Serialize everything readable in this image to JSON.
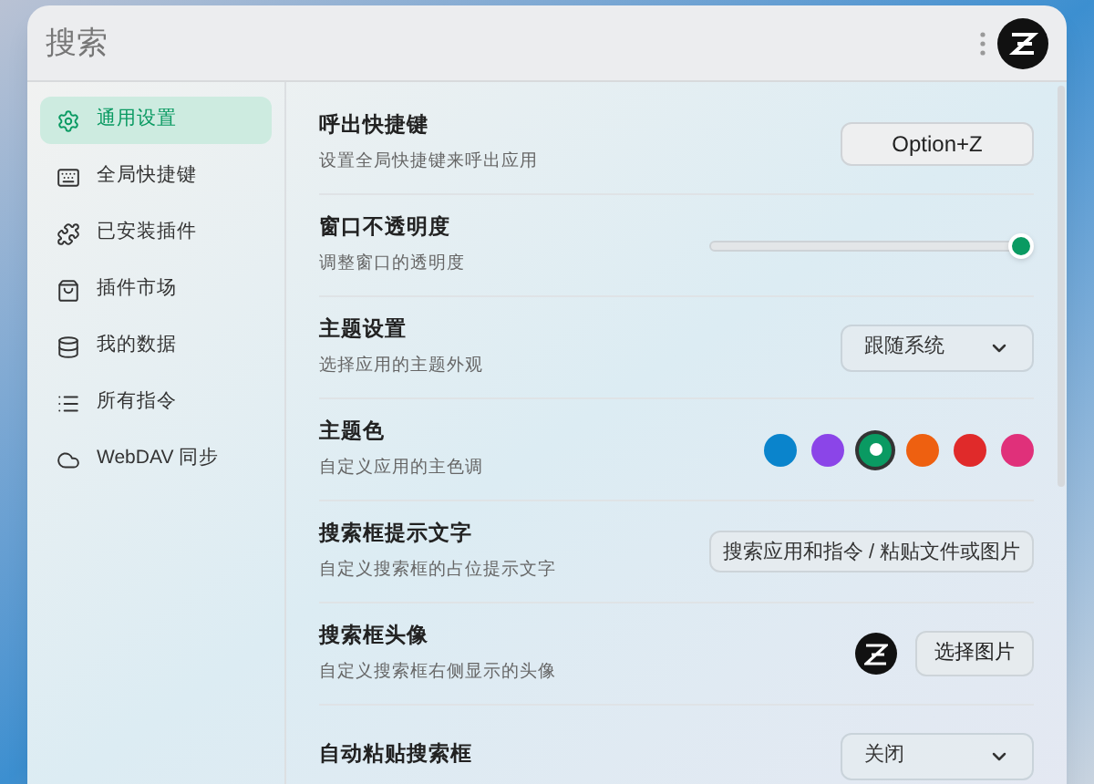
{
  "header": {
    "search": {
      "placeholder": "搜索"
    }
  },
  "sidebar": {
    "items": [
      {
        "label": "通用设置",
        "selected": true
      },
      {
        "label": "全局快捷键",
        "selected": false
      },
      {
        "label": "已安装插件",
        "selected": false
      },
      {
        "label": "插件市场",
        "selected": false
      },
      {
        "label": "我的数据",
        "selected": false
      },
      {
        "label": "所有指令",
        "selected": false
      },
      {
        "label": "WebDAV 同步",
        "selected": false
      }
    ]
  },
  "settings": [
    {
      "kind": "button",
      "title": "呼出快捷键",
      "subtitle": "设置全局快捷键来呼出应用",
      "value": "Option+Z"
    },
    {
      "kind": "slider",
      "title": "窗口不透明度",
      "subtitle": "调整窗口的透明度",
      "level": 1
    },
    {
      "kind": "select",
      "title": "主题设置",
      "subtitle": "选择应用的主题外观",
      "value": "跟随系统"
    },
    {
      "kind": "colors",
      "title": "主题色",
      "subtitle": "自定义应用的主色调",
      "colors": [
        {
          "color": "#0a84cc",
          "selected": false
        },
        {
          "color": "#8b45e8",
          "selected": false
        },
        {
          "color": "#0a9a62",
          "selected": true
        },
        {
          "color": "#ee6010",
          "selected": false
        },
        {
          "color": "#e02a2a",
          "selected": false
        },
        {
          "color": "#e0307a",
          "selected": false
        }
      ]
    },
    {
      "kind": "input",
      "title": "搜索框提示文字",
      "subtitle": "自定义搜索框的占位提示文字",
      "value": "搜索应用和指令 / 粘贴文件或图片"
    },
    {
      "kind": "avatar",
      "title": "搜索框头像",
      "subtitle": "自定义搜索框右侧显示的头像",
      "value": "选择图片"
    },
    {
      "kind": "select",
      "title": "自动粘贴搜索框",
      "value": "关闭"
    }
  ]
}
